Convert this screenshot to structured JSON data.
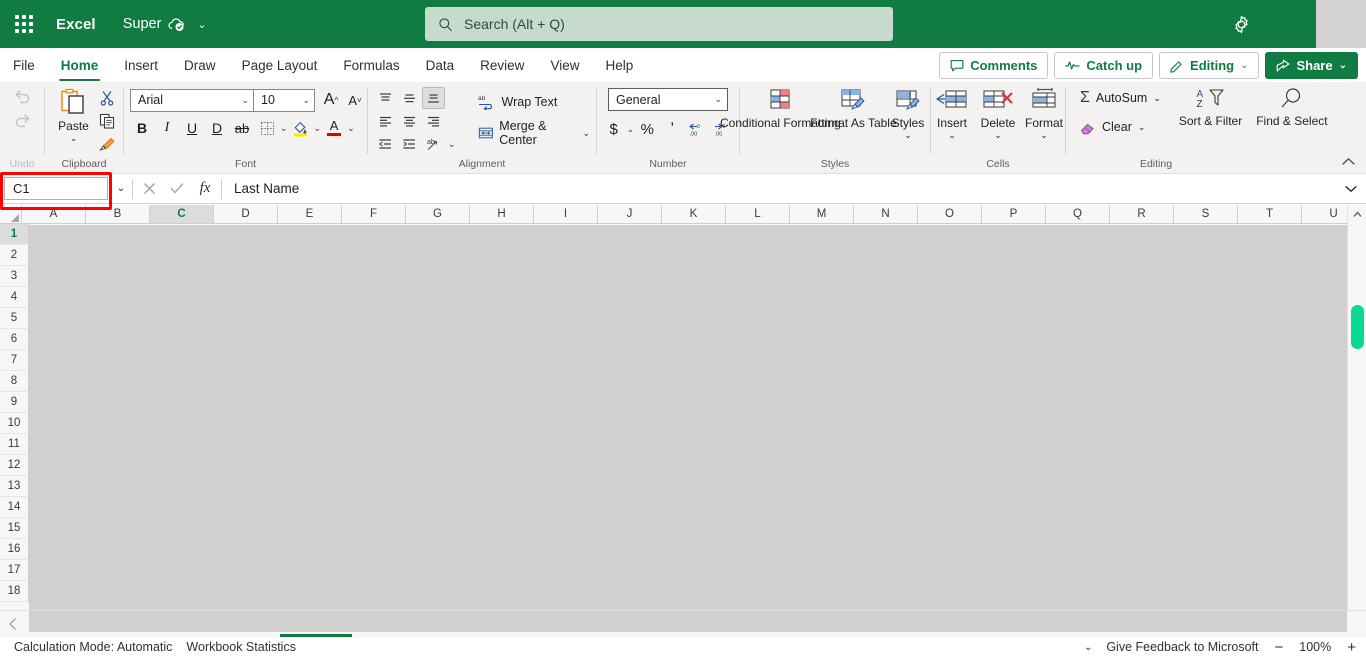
{
  "titlebar": {
    "waffle_label": "App launcher",
    "app_name": "Excel",
    "document_title": "Super",
    "cloud_icon": "cloud-saved-icon",
    "title_chevron": "⌄",
    "search_placeholder": "Search (Alt + Q)",
    "search_icon": "search-icon",
    "settings_icon": "gear-icon",
    "accent_color": "#107C41",
    "search_bg": "#c6dbcd"
  },
  "tabs": [
    {
      "label": "File",
      "active": false
    },
    {
      "label": "Home",
      "active": true
    },
    {
      "label": "Insert",
      "active": false
    },
    {
      "label": "Draw",
      "active": false
    },
    {
      "label": "Page Layout",
      "active": false
    },
    {
      "label": "Formulas",
      "active": false
    },
    {
      "label": "Data",
      "active": false
    },
    {
      "label": "Review",
      "active": false
    },
    {
      "label": "View",
      "active": false
    },
    {
      "label": "Help",
      "active": false
    }
  ],
  "tab_actions": {
    "comments": "Comments",
    "catch_up": "Catch up",
    "editing": "Editing",
    "share": "Share",
    "chevron": "⌄"
  },
  "ribbon": {
    "undo": {
      "label": "Undo",
      "undo_icon": "undo-arrow-icon",
      "redo_icon": "redo-arrow-icon"
    },
    "clipboard": {
      "label": "Clipboard",
      "paste": "Paste",
      "paste_chevron": "⌄",
      "cut_icon": "scissors-icon",
      "copy_icon": "copy-icon",
      "format_painter_icon": "format-painter-icon"
    },
    "font": {
      "label": "Font",
      "font_name": "Arial",
      "font_size": "10",
      "grow_font": "A",
      "shrink_font": "A",
      "bold": "B",
      "italic": "I",
      "underline": "U",
      "double_underline": "D",
      "strikethrough": "ab",
      "borders_icon": "borders-icon",
      "fill_color_icon": "fill-color-icon",
      "font_color_icon": "font-color-icon",
      "chevron": "⌄"
    },
    "alignment": {
      "label": "Alignment",
      "wrap_text": "Wrap Text",
      "merge_center": "Merge & Center",
      "wrap_icon": "wrap-text-icon",
      "merge_icon": "merge-cells-icon",
      "align_top_icon": "align-top-icon",
      "align_middle_icon": "align-middle-icon",
      "align_bottom_icon": "align-bottom-icon",
      "align_left_icon": "align-left-icon",
      "align_center_icon": "align-center-icon",
      "align_right_icon": "align-right-icon",
      "decrease_indent_icon": "decrease-indent-icon",
      "increase_indent_icon": "increase-indent-icon",
      "orientation_icon": "text-orientation-icon",
      "chevron": "⌄"
    },
    "number": {
      "label": "Number",
      "format": "General",
      "currency": "$",
      "percent": "%",
      "comma": "’",
      "increase_decimal_icon": "increase-decimal-icon",
      "decrease_decimal_icon": "decrease-decimal-icon",
      "chevron": "⌄"
    },
    "styles": {
      "label": "Styles",
      "conditional_formatting": "Conditional Formatting",
      "format_as_table": "Format As Table",
      "cell_styles": "Styles",
      "chevron": "⌄"
    },
    "cells": {
      "label": "Cells",
      "insert": "Insert",
      "delete": "Delete",
      "format": "Format",
      "chevron": "⌄"
    },
    "editing": {
      "label": "Editing",
      "autosum": "AutoSum",
      "clear": "Clear",
      "sort_filter": "Sort & Filter",
      "find_select": "Find & Select",
      "autosum_icon": "sigma-icon",
      "clear_icon": "eraser-icon",
      "sort_icon": "sort-filter-icon",
      "find_icon": "magnifier-icon",
      "chevron": "⌄"
    },
    "collapse_icon": "chevron-up-icon"
  },
  "formula_bar": {
    "name_box_value": "C1",
    "name_box_chevron": "⌄",
    "cancel_icon": "cancel-x-icon",
    "enter_icon": "confirm-check-icon",
    "fx_icon": "fx",
    "content": "Last Name",
    "expand_chevron": "⌄",
    "highlight_color": "#ff0000"
  },
  "grid": {
    "columns": [
      "A",
      "B",
      "C",
      "D",
      "E",
      "F",
      "G",
      "H",
      "I",
      "J",
      "K",
      "L",
      "M",
      "N",
      "O",
      "P",
      "Q",
      "R",
      "S",
      "T",
      "U"
    ],
    "selected_column": "C",
    "rows": [
      "1",
      "2",
      "3",
      "4",
      "5",
      "6",
      "7",
      "8",
      "9",
      "10",
      "11",
      "12",
      "13",
      "14",
      "15",
      "16",
      "17",
      "18"
    ],
    "selected_row": "1",
    "scroll_up_icon": "scroll-up-arrow",
    "scroll_down_icon": "scroll-down-arrow",
    "thumb_color": "#0ad88f"
  },
  "sheet_bar": {
    "prev_icon": "chevron-left-icon"
  },
  "status_bar": {
    "calculation_mode": "Calculation Mode: Automatic",
    "workbook_statistics": "Workbook Statistics",
    "chevron": "⌄",
    "feedback": "Give Feedback to Microsoft",
    "zoom_out": "−",
    "zoom_level": "100%",
    "zoom_in": "+"
  }
}
